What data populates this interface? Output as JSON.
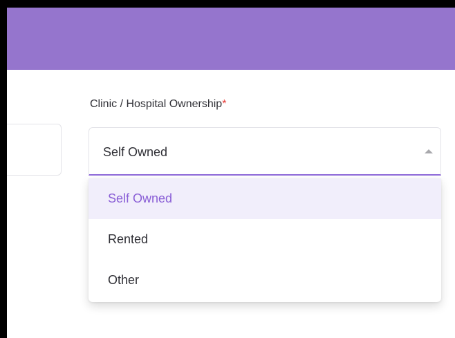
{
  "form": {
    "ownership_label": "Clinic / Hospital Ownership",
    "required_marker": "*",
    "selected_value": "Self Owned",
    "options": [
      "Self Owned",
      "Rented",
      "Other"
    ]
  },
  "colors": {
    "header": "#9575cd",
    "accent": "#8e6ad9",
    "selected_option_bg": "#f1eefb",
    "required": "#e53935"
  },
  "icons": {
    "select_caret": "caret-up-icon"
  }
}
